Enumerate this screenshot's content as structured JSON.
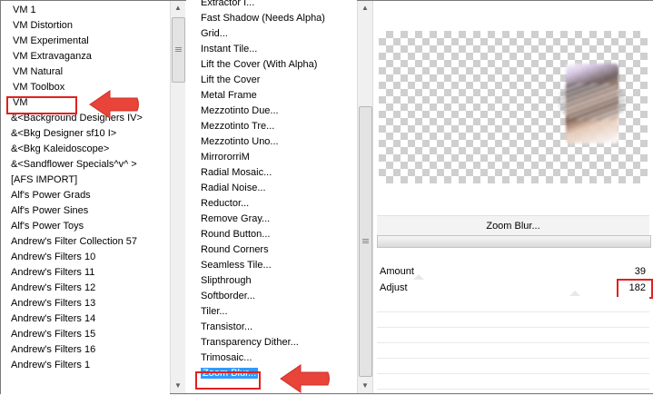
{
  "categories": [
    "VM 1",
    "VM Distortion",
    "VM Experimental",
    "VM Extravaganza",
    "VM Natural",
    "VM Toolbox",
    "VM",
    "&<Background Designers IV>",
    "&<Bkg Designer sf10 I>",
    "&<Bkg Kaleidoscope>",
    "&<Sandflower Specials^v^ >",
    "[AFS IMPORT]",
    "Alf's Power Grads",
    "Alf's Power Sines",
    "Alf's Power Toys",
    "Andrew's Filter Collection 57",
    "Andrew's Filters 10",
    "Andrew's Filters 11",
    "Andrew's Filters 12",
    "Andrew's Filters 13",
    "Andrew's Filters 14",
    "Andrew's Filters 15",
    "Andrew's Filters 16",
    "Andrew's Filters 1"
  ],
  "highlighted_category": "VM Toolbox",
  "filters": [
    "Extractor I...",
    "Fast Shadow (Needs Alpha)",
    "Grid...",
    "Instant Tile...",
    "Lift the Cover (With Alpha)",
    "Lift the Cover",
    "Metal Frame",
    "Mezzotinto Due...",
    "Mezzotinto Tre...",
    "Mezzotinto Uno...",
    "MirrororriM",
    "Radial Mosaic...",
    "Radial Noise...",
    "Reductor...",
    "Remove Gray...",
    "Round Button...",
    "Round Corners",
    "Seamless Tile...",
    "Slipthrough",
    "Softborder...",
    "Tiler...",
    "Transistor...",
    "Transparency Dither...",
    "Trimosaic...",
    "Zoom Blur..."
  ],
  "selected_filter": "Zoom Blur...",
  "effect": {
    "name": "Zoom Blur..."
  },
  "params": [
    {
      "label": "Amount",
      "value": "39"
    },
    {
      "label": "Adjust",
      "value": "182"
    }
  ],
  "highlight_color": "#e02020",
  "selection_color": "#3399ff"
}
